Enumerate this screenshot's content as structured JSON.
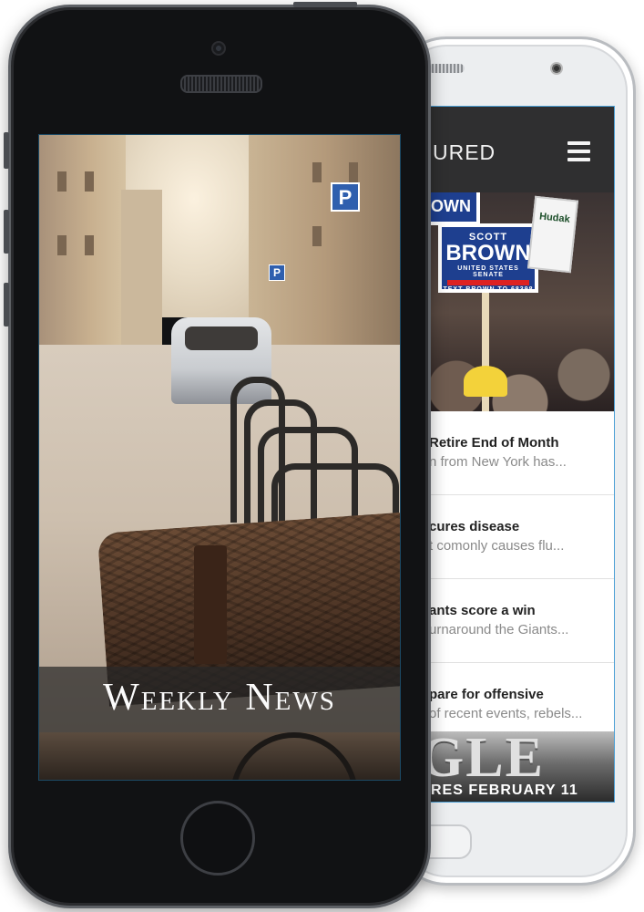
{
  "android_app": {
    "header_title": "URED",
    "menu_icon": "hamburger-menu-icon",
    "hero_signs": {
      "main_line1": "SCOTT",
      "main_line2": "BROWN",
      "main_line3": "UNITED STATES SENATE",
      "main_line4": "TEXT BROWN TO 68398",
      "top_line": "BROWN",
      "side_sign": "Hudak"
    },
    "news_items": [
      {
        "title": "Retire End of Month",
        "snippet": "n from New York has..."
      },
      {
        "title": "cures disease",
        "snippet": "t comonly causes flu..."
      },
      {
        "title": "ants score a win",
        "snippet": "urnaround the Giants..."
      },
      {
        "title": "pare for offensive",
        "snippet": "of recent events, rebels..."
      }
    ],
    "banner": {
      "big_text": "GLE",
      "small_text": "RES FEBRUARY 11"
    }
  },
  "iphone_app": {
    "splash_title": "Weekly News",
    "street_sign": "P"
  },
  "colors": {
    "header_bg": "#2f2f30",
    "accent_border": "#4b9fd5",
    "sign_blue": "#1e3f8f"
  }
}
